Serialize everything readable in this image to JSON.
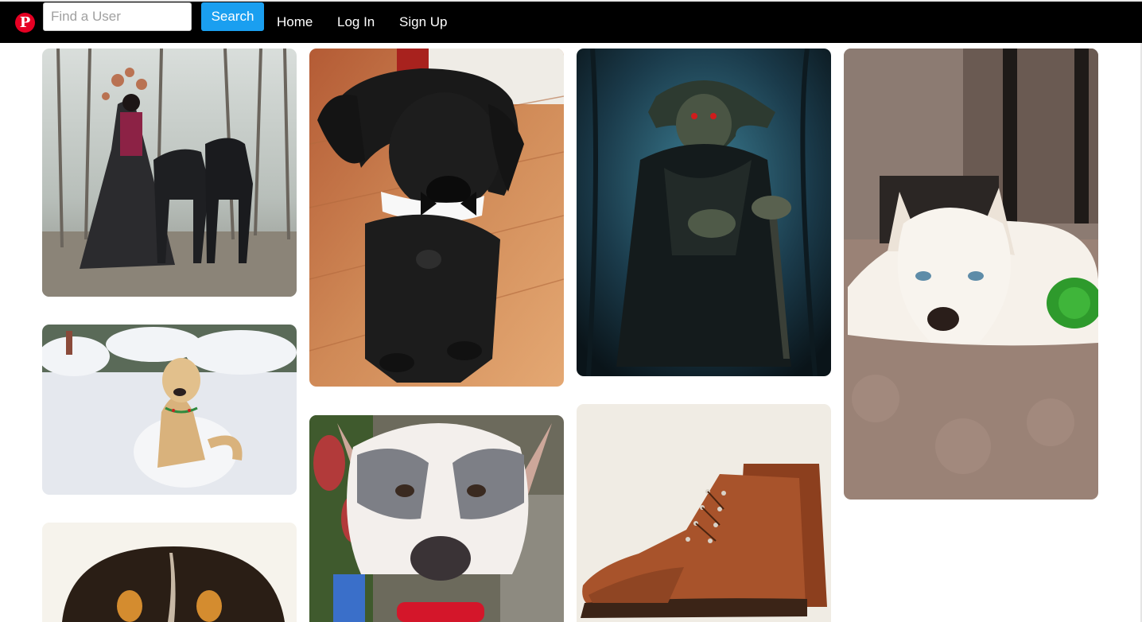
{
  "header": {
    "logo_icon": "pinterest-logo-icon",
    "logo_glyph": "P",
    "search_placeholder": "Find a User",
    "search_value": "",
    "search_button": "Search",
    "nav": [
      "Home",
      "Log In",
      "Sign Up"
    ]
  },
  "colors": {
    "navbar": "#000000",
    "brand": "#e60023",
    "search_button": "#1a9ff0"
  },
  "pins": [
    {
      "subject": "woman-with-great-danes"
    },
    {
      "subject": "golden-retriever-in-snow"
    },
    {
      "subject": "puppy-face"
    },
    {
      "subject": "black-puppy-with-bow-tie"
    },
    {
      "subject": "pit-bull-with-toy"
    },
    {
      "subject": "dark-yoda-artwork"
    },
    {
      "subject": "brown-leather-boots"
    },
    {
      "subject": "white-husky-on-carpet"
    }
  ]
}
